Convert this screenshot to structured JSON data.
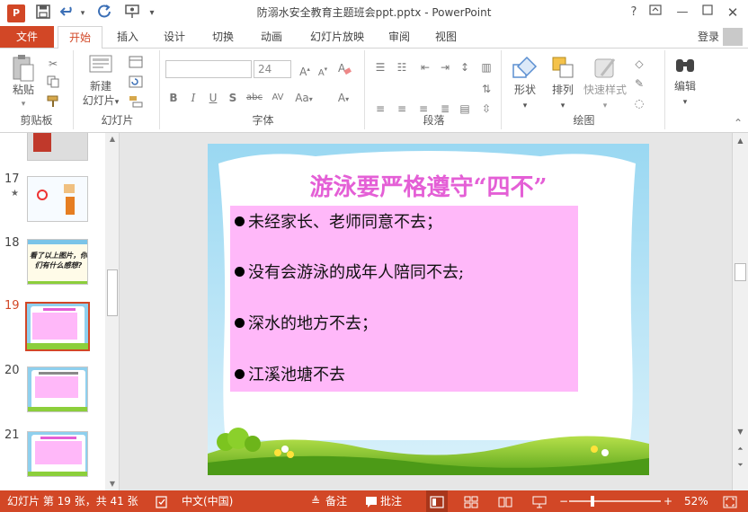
{
  "window": {
    "title": "防溺水安全教育主题班会ppt.pptx - PowerPoint",
    "app_icon": "P",
    "qat": [
      "save-icon",
      "undo-icon",
      "redo-icon",
      "presenter-icon",
      "customize-qat-icon"
    ],
    "controls": [
      "help-icon",
      "ribbon-display-icon",
      "minimize-icon",
      "maximize-icon",
      "close-icon"
    ]
  },
  "tabs": {
    "file": "文件",
    "items": [
      "开始",
      "插入",
      "设计",
      "切换",
      "动画",
      "幻灯片放映",
      "审阅",
      "视图"
    ],
    "active": "开始",
    "login": "登录"
  },
  "ribbon": {
    "clipboard": {
      "label": "剪贴板",
      "paste": "粘贴"
    },
    "slides": {
      "label": "幻灯片",
      "new_slide_line1": "新建",
      "new_slide_line2": "幻灯片"
    },
    "font": {
      "label": "字体",
      "font_name": "",
      "font_size": "24"
    },
    "paragraph": {
      "label": "段落"
    },
    "drawing": {
      "label": "绘图",
      "shapes": "形状",
      "arrange": "排列",
      "quick_styles": "快速样式"
    },
    "editing": {
      "label": "编辑",
      "edit": "编辑"
    }
  },
  "thumbnails": [
    {
      "number": "17",
      "star": "★",
      "current": false
    },
    {
      "number": "18",
      "current": false,
      "text": "看了以上图片，你们有什么感想?"
    },
    {
      "number": "19",
      "current": true
    },
    {
      "number": "20",
      "current": false
    },
    {
      "number": "21",
      "current": false
    }
  ],
  "slide": {
    "title": "游泳要严格遵守“四不”",
    "bullets": [
      "未经家长、老师同意不去；",
      "没有会游泳的成年人陪同不去;",
      "深水的地方不去；",
      "江溪池塘不去"
    ]
  },
  "status": {
    "slide_info": "幻灯片 第 19 张，共 41 张",
    "language": "中文(中国)",
    "notes": "备注",
    "comments": "批注",
    "zoom_percent": 52,
    "zoom": "52%",
    "zoom_minus": "−",
    "zoom_plus": "+"
  },
  "colors": {
    "accent": "#d24726",
    "slide_title": "#e45fd6",
    "slide_box": "#ffb8f9",
    "sky": "#8fd0ee",
    "grass": "#7cc41f"
  }
}
